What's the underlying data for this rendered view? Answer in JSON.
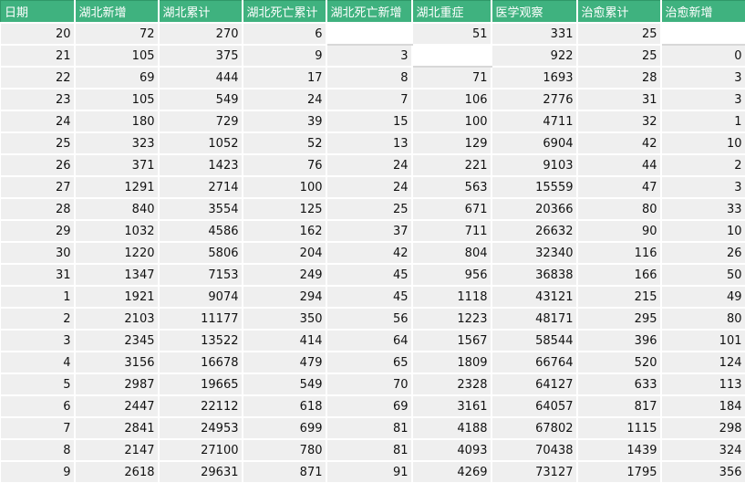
{
  "table": {
    "headers": [
      "日期",
      "湖北新增",
      "湖北累计",
      "湖北死亡累计",
      "湖北死亡新增",
      "湖北重症",
      "医学观察",
      "治愈累计",
      "治愈新增"
    ],
    "rows": [
      [
        "20",
        "72",
        "270",
        "6",
        "",
        "51",
        "331",
        "25",
        ""
      ],
      [
        "21",
        "105",
        "375",
        "9",
        "3",
        "",
        "922",
        "25",
        "0"
      ],
      [
        "22",
        "69",
        "444",
        "17",
        "8",
        "71",
        "1693",
        "28",
        "3"
      ],
      [
        "23",
        "105",
        "549",
        "24",
        "7",
        "106",
        "2776",
        "31",
        "3"
      ],
      [
        "24",
        "180",
        "729",
        "39",
        "15",
        "100",
        "4711",
        "32",
        "1"
      ],
      [
        "25",
        "323",
        "1052",
        "52",
        "13",
        "129",
        "6904",
        "42",
        "10"
      ],
      [
        "26",
        "371",
        "1423",
        "76",
        "24",
        "221",
        "9103",
        "44",
        "2"
      ],
      [
        "27",
        "1291",
        "2714",
        "100",
        "24",
        "563",
        "15559",
        "47",
        "3"
      ],
      [
        "28",
        "840",
        "3554",
        "125",
        "25",
        "671",
        "20366",
        "80",
        "33"
      ],
      [
        "29",
        "1032",
        "4586",
        "162",
        "37",
        "711",
        "26632",
        "90",
        "10"
      ],
      [
        "30",
        "1220",
        "5806",
        "204",
        "42",
        "804",
        "32340",
        "116",
        "26"
      ],
      [
        "31",
        "1347",
        "7153",
        "249",
        "45",
        "956",
        "36838",
        "166",
        "50"
      ],
      [
        "1",
        "1921",
        "9074",
        "294",
        "45",
        "1118",
        "43121",
        "215",
        "49"
      ],
      [
        "2",
        "2103",
        "11177",
        "350",
        "56",
        "1223",
        "48171",
        "295",
        "80"
      ],
      [
        "3",
        "2345",
        "13522",
        "414",
        "64",
        "1567",
        "58544",
        "396",
        "101"
      ],
      [
        "4",
        "3156",
        "16678",
        "479",
        "65",
        "1809",
        "66764",
        "520",
        "124"
      ],
      [
        "5",
        "2987",
        "19665",
        "549",
        "70",
        "2328",
        "64127",
        "633",
        "113"
      ],
      [
        "6",
        "2447",
        "22112",
        "618",
        "69",
        "3161",
        "64057",
        "817",
        "184"
      ],
      [
        "7",
        "2841",
        "24953",
        "699",
        "81",
        "4188",
        "67802",
        "1115",
        "298"
      ],
      [
        "8",
        "2147",
        "27100",
        "780",
        "81",
        "4093",
        "70438",
        "1439",
        "324"
      ],
      [
        "9",
        "2618",
        "29631",
        "871",
        "91",
        "4269",
        "73127",
        "1795",
        "356"
      ]
    ]
  },
  "colors": {
    "header_bg": "#3fb27f",
    "header_text": "#ffffff",
    "cell_bg": "#efefef",
    "blank_cell_bg": "#ffffff"
  }
}
